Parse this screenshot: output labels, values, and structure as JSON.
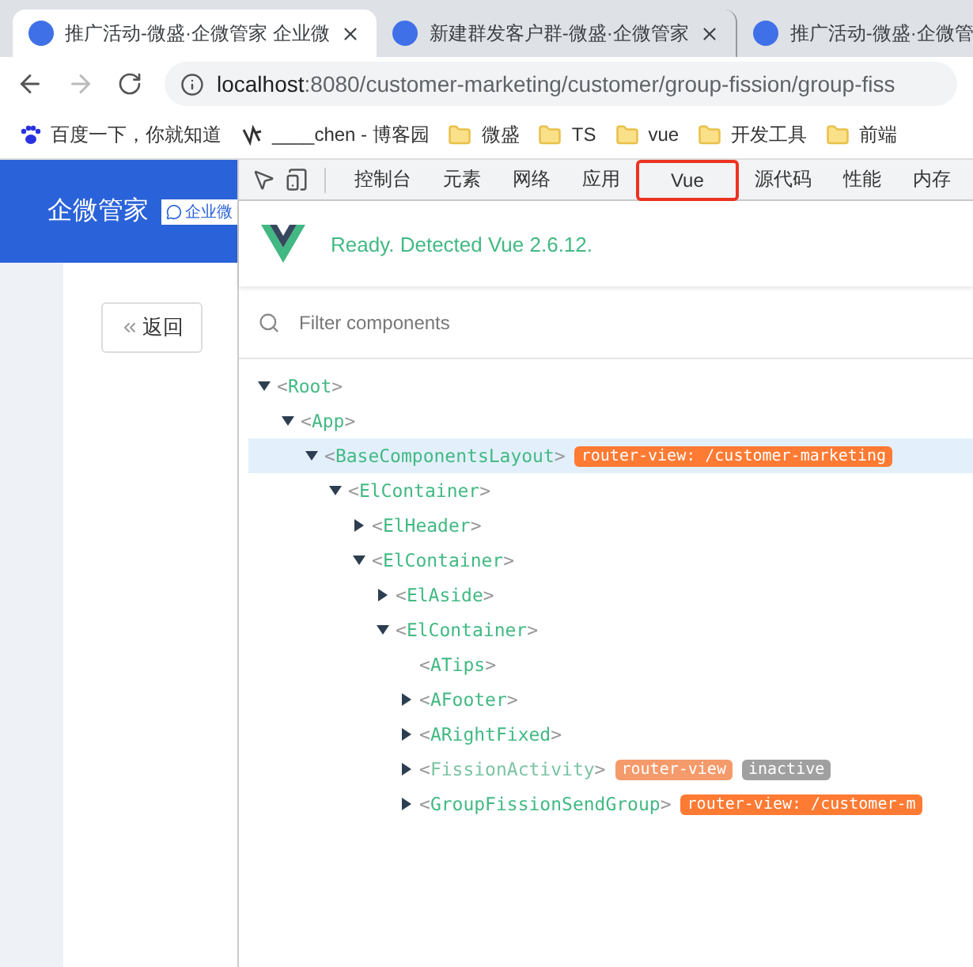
{
  "browser": {
    "tabs": [
      {
        "title": "推广活动-微盛·企微管家 企业微",
        "selected": true
      },
      {
        "title": "新建群发客户群-微盛·企微管家",
        "selected": false
      },
      {
        "title": "推广活动-微盛·企微管",
        "selected": false
      }
    ],
    "url_host": "localhost",
    "url_rest": ":8080/customer-marketing/customer/group-fission/group-fiss",
    "bookmarks": [
      {
        "kind": "paw",
        "label": "百度一下，你就知道"
      },
      {
        "kind": "glyph",
        "label": "____chen - 博客园"
      },
      {
        "kind": "folder",
        "label": "微盛"
      },
      {
        "kind": "folder",
        "label": "TS"
      },
      {
        "kind": "folder",
        "label": "vue"
      },
      {
        "kind": "folder",
        "label": "开发工具"
      },
      {
        "kind": "folder",
        "label": "前端"
      }
    ]
  },
  "page": {
    "logo": "企微管家",
    "logo_badge": "企业微",
    "back_button": "返回"
  },
  "devtools": {
    "tabs": [
      {
        "label": "控制台",
        "selected": false
      },
      {
        "label": "元素",
        "selected": false
      },
      {
        "label": "网络",
        "selected": false
      },
      {
        "label": "应用",
        "selected": false
      },
      {
        "label": "Vue",
        "selected": true
      },
      {
        "label": "源代码",
        "selected": false
      },
      {
        "label": "性能",
        "selected": false
      },
      {
        "label": "内存",
        "selected": false
      }
    ],
    "status": "Ready. Detected Vue 2.6.12.",
    "filter": {
      "placeholder": "Filter components"
    },
    "tree": [
      {
        "name": "<Root>",
        "expanded": true,
        "selected": false,
        "children": [
          {
            "name": "<App>",
            "expanded": true,
            "selected": false,
            "children": [
              {
                "name": "<BaseComponentsLayout>",
                "expanded": true,
                "selected": true,
                "badges": [
                  {
                    "text": "router-view: /customer-marketing",
                    "kind": "router"
                  }
                ],
                "children": [
                  {
                    "name": "<ElContainer>",
                    "expanded": true,
                    "selected": false,
                    "children": [
                      {
                        "name": "<ElHeader>",
                        "expanded": false,
                        "selected": false
                      },
                      {
                        "name": "<ElContainer>",
                        "expanded": true,
                        "selected": false,
                        "children": [
                          {
                            "name": "<ElAside>",
                            "expanded": false,
                            "selected": false
                          },
                          {
                            "name": "<ElContainer>",
                            "expanded": true,
                            "selected": false,
                            "children": [
                              {
                                "name": "<ATips>",
                                "selected": false
                              },
                              {
                                "name": "<AFooter>",
                                "expanded": false,
                                "selected": false
                              },
                              {
                                "name": "<ARightFixed>",
                                "expanded": false,
                                "selected": false
                              },
                              {
                                "name": "<FissionActivity>",
                                "expanded": false,
                                "selected": false,
                                "inactive": true,
                                "badges": [
                                  {
                                    "text": "router-view",
                                    "kind": "router"
                                  },
                                  {
                                    "text": "inactive",
                                    "kind": "inactive"
                                  }
                                ]
                              },
                              {
                                "name": "<GroupFissionSendGroup>",
                                "expanded": false,
                                "selected": false,
                                "badges": [
                                  {
                                    "text": "router-view: /customer-m",
                                    "kind": "router"
                                  }
                                ]
                              }
                            ]
                          }
                        ]
                      }
                    ]
                  }
                ]
              }
            ]
          }
        ]
      }
    ]
  }
}
